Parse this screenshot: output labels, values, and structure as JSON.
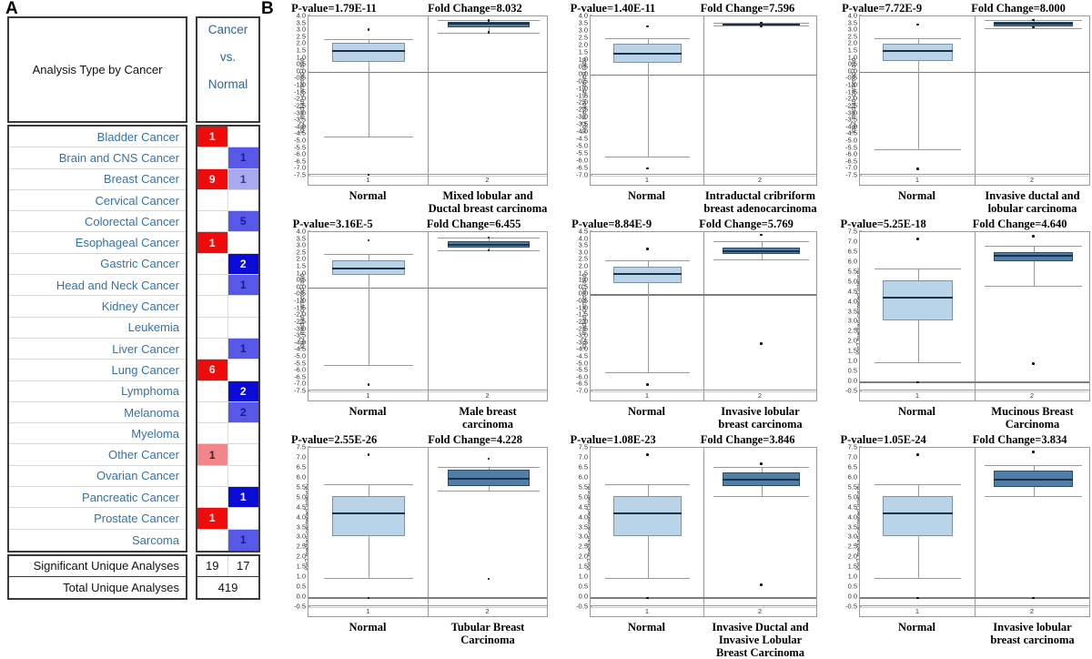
{
  "panel_a": {
    "letter": "A",
    "header_left": "Analysis Type by Cancer",
    "header_right": "Cancer vs. Normal",
    "header_right_lines": [
      "Cancer",
      "vs.",
      "Normal"
    ],
    "rows": [
      {
        "label": "Bladder Cancer",
        "over": "1",
        "under": ""
      },
      {
        "label": "Brain and CNS Cancer",
        "over": "",
        "under": "1"
      },
      {
        "label": "Breast Cancer",
        "over": "9",
        "under": "1"
      },
      {
        "label": "Cervical Cancer",
        "over": "",
        "under": ""
      },
      {
        "label": "Colorectal Cancer",
        "over": "",
        "under": "5"
      },
      {
        "label": "Esophageal Cancer",
        "over": "1",
        "under": ""
      },
      {
        "label": "Gastric Cancer",
        "over": "",
        "under": "2"
      },
      {
        "label": "Head and Neck Cancer",
        "over": "",
        "under": "1"
      },
      {
        "label": "Kidney Cancer",
        "over": "",
        "under": ""
      },
      {
        "label": "Leukemia",
        "over": "",
        "under": ""
      },
      {
        "label": "Liver Cancer",
        "over": "",
        "under": "1"
      },
      {
        "label": "Lung Cancer",
        "over": "6",
        "under": ""
      },
      {
        "label": "Lymphoma",
        "over": "",
        "under": "2"
      },
      {
        "label": "Melanoma",
        "over": "",
        "under": "2"
      },
      {
        "label": "Myeloma",
        "over": "",
        "under": ""
      },
      {
        "label": "Other Cancer",
        "over": "1",
        "under": ""
      },
      {
        "label": "Ovarian Cancer",
        "over": "",
        "under": ""
      },
      {
        "label": "Pancreatic Cancer",
        "over": "",
        "under": "1"
      },
      {
        "label": "Prostate Cancer",
        "over": "1",
        "under": ""
      },
      {
        "label": "Sarcoma",
        "over": "",
        "under": "1"
      }
    ],
    "cell_colors": {
      "over": [
        "#ee0b0b",
        "",
        "#ee0b0b",
        "",
        "",
        "#ee0b0b",
        "",
        "",
        "",
        "",
        "",
        "#ee0b0b",
        "",
        "",
        "",
        "#f4868b",
        "",
        "",
        "#ee0b0b",
        ""
      ],
      "under": [
        "",
        "#5757e8",
        "#a9a9f0",
        "",
        "#5757e8",
        "",
        "#0b0bd6",
        "#5757e8",
        "",
        "",
        "#5757e8",
        "",
        "#0b0bd6",
        "#5757e8",
        "",
        "",
        "",
        "#0b0bd6",
        "",
        "#5757e8"
      ],
      "over_text": [
        "#ffffff",
        "",
        "#ffffff",
        "",
        "",
        "#ffffff",
        "",
        "",
        "",
        "",
        "",
        "#ffffff",
        "",
        "",
        "",
        "#2a2a2a",
        "",
        "",
        "#ffffff",
        ""
      ],
      "under_text": [
        "",
        "#1a1a8a",
        "#33339a",
        "",
        "#1a1a8a",
        "",
        "#ffffff",
        "#1a1a8a",
        "",
        "",
        "#1a1a8a",
        "",
        "#ffffff",
        "#1a1a8a",
        "",
        "",
        "",
        "#ffffff",
        "",
        "#1a1a8a"
      ]
    },
    "summary": [
      {
        "label": "Significant Unique Analyses",
        "over": "19",
        "under": "17"
      },
      {
        "label": "Total Unique Analyses",
        "total": "419"
      }
    ]
  },
  "panel_b": {
    "letter": "B",
    "normal_label": "Normal",
    "x_tick_left": "1",
    "x_tick_right": "2"
  },
  "chart_data": [
    {
      "id": "chart-1",
      "type": "box",
      "title_pvalue": "P-value=1.79E-11",
      "title_fold": "Fold Change=8.032",
      "ylabel": "log2 median-centered ratio",
      "ylim": [
        -7.5,
        4.0
      ],
      "ytick_step": 0.5,
      "yticks": [
        "4.0",
        "3.5",
        "3.0",
        "2.5",
        "2.0",
        "1.5",
        "1.0",
        "0.5",
        "0.0",
        "-0.5",
        "-1.0",
        "-1.5",
        "-2.0",
        "-2.5",
        "-3.0",
        "-3.5",
        "-4.0",
        "-4.5",
        "-5.0",
        "-5.5",
        "-6.0",
        "-6.5",
        "-7.0",
        "-7.5"
      ],
      "zero_line": 0.0,
      "base_line": -7.5,
      "groups": [
        {
          "name": "Normal",
          "xlabel_lines": [
            "Normal"
          ],
          "q1": 0.7,
          "median": 1.5,
          "q3": 2.1,
          "whisker_low": -4.65,
          "whisker_high": 2.35,
          "outliers": [
            3.05,
            -7.45
          ],
          "fill": "normal"
        },
        {
          "name": "Mixed lobular and Ductal breast carcinoma",
          "xlabel_lines": [
            "Mixed lobular and",
            "Ductal breast carcinoma"
          ],
          "q1": 3.2,
          "median": 3.45,
          "q3": 3.6,
          "whisker_low": 2.85,
          "whisker_high": 3.75,
          "outliers": [
            3.7,
            2.85
          ],
          "fill": "tumor"
        }
      ]
    },
    {
      "id": "chart-2",
      "type": "box",
      "title_pvalue": "P-value=1.40E-11",
      "title_fold": "Fold Change=7.596",
      "ylabel": "log2 median-centered ratio",
      "ylim": [
        -7.0,
        4.0
      ],
      "ytick_step": 0.5,
      "yticks": [
        "4.0",
        "3.5",
        "3.0",
        "2.5",
        "2.0",
        "1.5",
        "1.0",
        "0.5",
        "0.0",
        "-0.5",
        "-1.0",
        "-1.5",
        "-2.0",
        "-2.5",
        "-3.0",
        "-3.5",
        "-4.0",
        "-4.5",
        "-5.0",
        "-5.5",
        "-6.0",
        "-6.5",
        "-7.0"
      ],
      "zero_line": 0.0,
      "base_line": -7.0,
      "groups": [
        {
          "name": "Normal",
          "xlabel_lines": [
            "Normal"
          ],
          "q1": 0.8,
          "median": 1.4,
          "q3": 2.1,
          "whisker_low": -5.65,
          "whisker_high": 2.5,
          "outliers": [
            3.3,
            -6.5
          ],
          "fill": "normal"
        },
        {
          "name": "Intraductal cribriform breast adenocarcinoma",
          "xlabel_lines": [
            "Intraductal cribriform",
            "breast adenocarcinoma"
          ],
          "q1": 3.4,
          "median": 3.45,
          "q3": 3.5,
          "whisker_low": 3.35,
          "whisker_high": 3.55,
          "outliers": [
            3.55,
            3.3
          ],
          "fill": "tumor"
        }
      ]
    },
    {
      "id": "chart-3",
      "type": "box",
      "title_pvalue": "P-value=7.72E-9",
      "title_fold": "Fold Change=8.000",
      "ylabel": "log2 median-centered ratio",
      "ylim": [
        -7.5,
        4.0
      ],
      "ytick_step": 0.5,
      "yticks": [
        "4.0",
        "3.5",
        "3.0",
        "2.5",
        "2.0",
        "1.5",
        "1.0",
        "0.5",
        "0.0",
        "-0.5",
        "-1.0",
        "-1.5",
        "-2.0",
        "-2.5",
        "-3.0",
        "-3.5",
        "-4.0",
        "-4.5",
        "-5.0",
        "-5.5",
        "-6.0",
        "-6.5",
        "-7.0",
        "-7.5"
      ],
      "zero_line": 0.0,
      "base_line": -7.5,
      "groups": [
        {
          "name": "Normal",
          "xlabel_lines": [
            "Normal"
          ],
          "q1": 0.8,
          "median": 1.5,
          "q3": 2.0,
          "whisker_low": -5.6,
          "whisker_high": 2.4,
          "outliers": [
            3.4,
            -7.0
          ],
          "fill": "normal"
        },
        {
          "name": "Invasive ductal and lobular carcinoma",
          "xlabel_lines": [
            "Invasive ductal and",
            "lobular carcinoma"
          ],
          "q1": 3.3,
          "median": 3.45,
          "q3": 3.6,
          "whisker_low": 3.15,
          "whisker_high": 3.75,
          "outliers": [
            3.75,
            3.2
          ],
          "fill": "tumor"
        }
      ]
    },
    {
      "id": "chart-4",
      "type": "box",
      "title_pvalue": "P-value=3.16E-5",
      "title_fold": "Fold Change=6.455",
      "ylabel": "log2 median-centered ratio",
      "ylim": [
        -7.5,
        4.0
      ],
      "ytick_step": 0.5,
      "yticks": [
        "4.0",
        "3.5",
        "3.0",
        "2.5",
        "2.0",
        "1.5",
        "1.0",
        "0.5",
        "0.0",
        "-0.5",
        "-1.0",
        "-1.5",
        "-2.0",
        "-2.5",
        "-3.0",
        "-3.5",
        "-4.0",
        "-4.5",
        "-5.0",
        "-5.5",
        "-6.0",
        "-6.5",
        "-7.0",
        "-7.5"
      ],
      "zero_line": 0.0,
      "base_line": -7.5,
      "groups": [
        {
          "name": "Normal",
          "xlabel_lines": [
            "Normal"
          ],
          "q1": 0.9,
          "median": 1.4,
          "q3": 1.95,
          "whisker_low": -5.6,
          "whisker_high": 2.4,
          "outliers": [
            3.4,
            -7.0
          ],
          "fill": "normal"
        },
        {
          "name": "Male breast carcinoma",
          "xlabel_lines": [
            "Male breast",
            "carcinoma"
          ],
          "q1": 2.85,
          "median": 3.1,
          "q3": 3.35,
          "whisker_low": 2.7,
          "whisker_high": 3.6,
          "outliers": [
            3.6,
            2.7
          ],
          "fill": "tumor"
        }
      ]
    },
    {
      "id": "chart-5",
      "type": "box",
      "title_pvalue": "P-value=8.84E-9",
      "title_fold": "Fold Change=5.769",
      "ylabel": "log2 median-centered ratio",
      "ylim": [
        -7.0,
        4.5
      ],
      "ytick_step": 0.5,
      "yticks": [
        "4.5",
        "4.0",
        "3.5",
        "3.0",
        "2.5",
        "2.0",
        "1.5",
        "1.0",
        "0.5",
        "0.0",
        "-0.5",
        "-1.0",
        "-1.5",
        "-2.0",
        "-2.5",
        "-3.0",
        "-3.5",
        "-4.0",
        "-4.5",
        "-5.0",
        "-5.5",
        "-6.0",
        "-6.5",
        "-7.0"
      ],
      "zero_line": 0.0,
      "base_line": -7.0,
      "groups": [
        {
          "name": "Normal",
          "xlabel_lines": [
            "Normal"
          ],
          "q1": 0.85,
          "median": 1.5,
          "q3": 2.0,
          "whisker_low": -5.6,
          "whisker_high": 2.45,
          "outliers": [
            3.3,
            -6.5
          ],
          "fill": "normal"
        },
        {
          "name": "Invasive lobular breast carcinoma",
          "xlabel_lines": [
            "Invasive lobular",
            "breast carcinoma"
          ],
          "q1": 2.9,
          "median": 3.15,
          "q3": 3.4,
          "whisker_low": 2.5,
          "whisker_high": 3.85,
          "outliers": [
            4.3,
            -3.55
          ],
          "fill": "tumor"
        }
      ]
    },
    {
      "id": "chart-6",
      "type": "box",
      "title_pvalue": "P-value=5.25E-18",
      "title_fold": "Fold Change=4.640",
      "ylabel": "log2 median-centered intensity",
      "ylim": [
        -0.5,
        7.5
      ],
      "ytick_step": 0.5,
      "yticks": [
        "7.5",
        "7.0",
        "6.5",
        "6.0",
        "5.5",
        "5.0",
        "4.5",
        "4.0",
        "3.5",
        "3.0",
        "2.5",
        "2.0",
        "1.5",
        "1.0",
        "0.5",
        "0.0",
        "-0.5"
      ],
      "zero_line": 0.0,
      "base_line": -0.5,
      "groups": [
        {
          "name": "Normal",
          "xlabel_lines": [
            "Normal"
          ],
          "q1": 3.05,
          "median": 4.2,
          "q3": 5.1,
          "whisker_low": 0.98,
          "whisker_high": 5.65,
          "outliers": [
            7.15,
            -0.05
          ],
          "fill": "normal"
        },
        {
          "name": "Mucinous Breast Carcinoma",
          "xlabel_lines": [
            "Mucinous Breast",
            "Carcinoma"
          ],
          "q1": 6.05,
          "median": 6.3,
          "q3": 6.5,
          "whisker_low": 4.8,
          "whisker_high": 6.8,
          "outliers": [
            7.3,
            0.9
          ],
          "fill": "tumor"
        }
      ]
    },
    {
      "id": "chart-7",
      "type": "box",
      "title_pvalue": "P-value=2.55E-26",
      "title_fold": "Fold Change=4.228",
      "ylabel": "log2 median-centered intensity",
      "ylim": [
        -0.5,
        7.5
      ],
      "ytick_step": 0.5,
      "yticks": [
        "7.5",
        "7.0",
        "6.5",
        "6.0",
        "5.5",
        "5.0",
        "4.5",
        "4.0",
        "3.5",
        "3.0",
        "2.5",
        "2.0",
        "1.5",
        "1.0",
        "0.5",
        "0.0",
        "-0.5"
      ],
      "zero_line": 0.0,
      "base_line": -0.5,
      "groups": [
        {
          "name": "Normal",
          "xlabel_lines": [
            "Normal"
          ],
          "q1": 3.05,
          "median": 4.2,
          "q3": 5.1,
          "whisker_low": 0.98,
          "whisker_high": 5.65,
          "outliers": [
            7.15,
            -0.05
          ],
          "fill": "normal"
        },
        {
          "name": "Tubular Breast Carcinoma",
          "xlabel_lines": [
            "Tubular Breast",
            "Carcinoma"
          ],
          "q1": 5.6,
          "median": 5.95,
          "q3": 6.4,
          "whisker_low": 5.35,
          "whisker_high": 6.55,
          "outliers": [
            6.95,
            0.92
          ],
          "fill": "tumor"
        }
      ]
    },
    {
      "id": "chart-8",
      "type": "box",
      "title_pvalue": "P-value=1.08E-23",
      "title_fold": "Fold Change=3.846",
      "ylabel": "log2 median-centered intensity",
      "ylim": [
        -0.5,
        7.5
      ],
      "ytick_step": 0.5,
      "yticks": [
        "7.5",
        "7.0",
        "6.5",
        "6.0",
        "5.5",
        "5.0",
        "4.5",
        "4.0",
        "3.5",
        "3.0",
        "2.5",
        "2.0",
        "1.5",
        "1.0",
        "0.5",
        "0.0",
        "-0.5"
      ],
      "zero_line": 0.0,
      "base_line": -0.5,
      "groups": [
        {
          "name": "Normal",
          "xlabel_lines": [
            "Normal"
          ],
          "q1": 3.05,
          "median": 4.2,
          "q3": 5.1,
          "whisker_low": 0.98,
          "whisker_high": 5.65,
          "outliers": [
            7.15,
            -0.05
          ],
          "fill": "normal"
        },
        {
          "name": "Invasive Ductal and Invasive Lobular Breast Carcinoma",
          "xlabel_lines": [
            "Invasive Ductal and",
            "Invasive Lobular",
            "Breast Carcinoma"
          ],
          "q1": 5.6,
          "median": 5.88,
          "q3": 6.25,
          "whisker_low": 5.08,
          "whisker_high": 6.52,
          "outliers": [
            6.7,
            0.62
          ],
          "fill": "tumor"
        }
      ]
    },
    {
      "id": "chart-9",
      "type": "box",
      "title_pvalue": "P-value=1.05E-24",
      "title_fold": "Fold Change=3.834",
      "ylabel": "log2 median-centered intensity",
      "ylim": [
        -0.5,
        7.5
      ],
      "ytick_step": 0.5,
      "yticks": [
        "7.5",
        "7.0",
        "6.5",
        "6.0",
        "5.5",
        "5.0",
        "4.5",
        "4.0",
        "3.5",
        "3.0",
        "2.5",
        "2.0",
        "1.5",
        "1.0",
        "0.5",
        "0.0",
        "-0.5"
      ],
      "zero_line": 0.0,
      "base_line": -0.5,
      "groups": [
        {
          "name": "Normal",
          "xlabel_lines": [
            "Normal"
          ],
          "q1": 3.05,
          "median": 4.2,
          "q3": 5.1,
          "whisker_low": 0.98,
          "whisker_high": 5.65,
          "outliers": [
            7.15,
            -0.05
          ],
          "fill": "normal"
        },
        {
          "name": "Invasive lobular breast carcinoma",
          "xlabel_lines": [
            "Invasive lobular",
            "breast carcinoma"
          ],
          "q1": 5.55,
          "median": 5.88,
          "q3": 6.35,
          "whisker_low": 5.1,
          "whisker_high": 6.65,
          "outliers": [
            7.3,
            -0.05
          ],
          "fill": "tumor"
        }
      ]
    }
  ]
}
